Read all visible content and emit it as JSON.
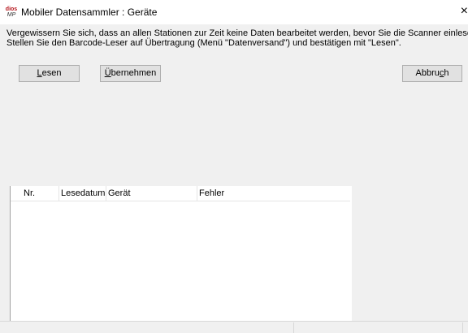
{
  "window": {
    "icon_line1": "dios",
    "icon_line2": "MP",
    "title": "Mobiler Datensammler : Geräte",
    "close_glyph": "×"
  },
  "instructions": {
    "line1": "Vergewissern Sie sich, dass an allen Stationen zur Zeit keine Daten bearbeitet werden, bevor Sie die Scanner einlesen.",
    "line2": "Stellen Sie den Barcode-Leser auf Übertragung (Menü \"Datenversand\") und bestätigen mit \"Lesen\"."
  },
  "buttons": {
    "read": {
      "mnemonic": "L",
      "rest": "esen"
    },
    "apply": {
      "mnemonic": "Ü",
      "rest": "bernehmen"
    },
    "cancel": {
      "before": "Abbru",
      "mnemonic": "c",
      "after": "h"
    }
  },
  "table": {
    "columns": [
      "Nr.",
      "Lesedatum",
      "Gerät",
      "Fehler"
    ],
    "rows": []
  }
}
